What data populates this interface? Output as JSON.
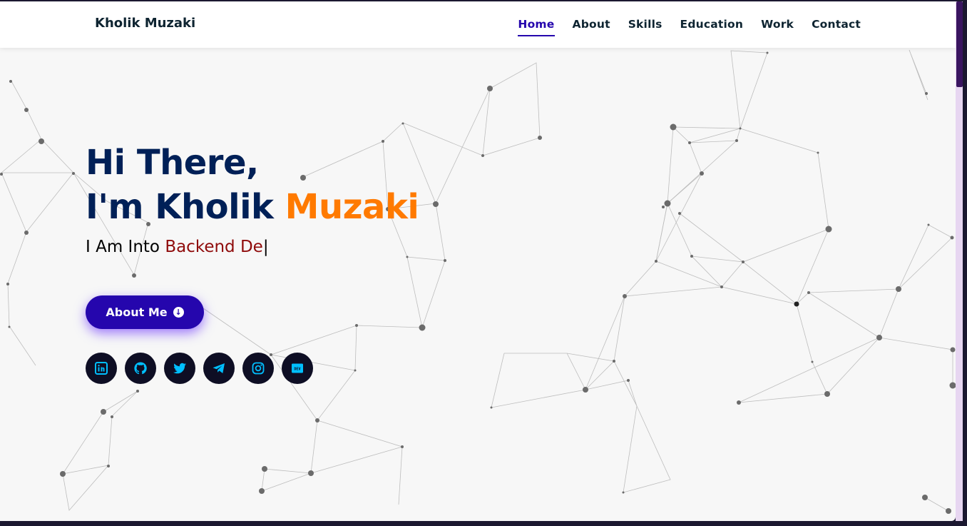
{
  "navbar": {
    "brand": "Kholik Muzaki",
    "links": [
      "Home",
      "About",
      "Skills",
      "Education",
      "Work",
      "Contact"
    ],
    "active": "Home"
  },
  "hero": {
    "line1": "Hi There,",
    "line2_prefix": "I'm Kholik ",
    "line2_accent": "Muzaki",
    "sub_prefix": "I Am Into ",
    "sub_typed": "Backend De",
    "cursor": "|",
    "button_label": "About Me"
  },
  "socials": [
    {
      "icon": "linkedin-icon"
    },
    {
      "icon": "github-icon"
    },
    {
      "icon": "twitter-icon"
    },
    {
      "icon": "telegram-icon"
    },
    {
      "icon": "instagram-icon"
    },
    {
      "icon": "dev-icon",
      "text": "DEV"
    }
  ],
  "colors": {
    "primary": "#2506ad",
    "heading": "#002057",
    "accent": "#ff7a00",
    "typed": "#8f0b0b",
    "social_bg": "#0e0e24",
    "social_icon": "#00bfff"
  }
}
